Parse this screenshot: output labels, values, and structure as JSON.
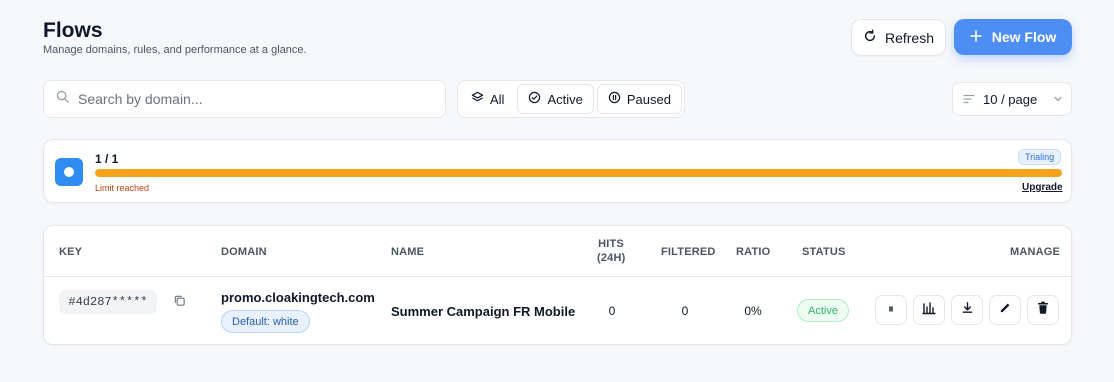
{
  "header": {
    "title": "Flows",
    "subtitle": "Manage domains, rules, and performance at a glance."
  },
  "actions": {
    "refresh_label": "Refresh",
    "new_flow_label": "New Flow"
  },
  "search": {
    "placeholder": "Search by domain...",
    "value": ""
  },
  "filters": [
    {
      "label": "All",
      "icon": "layers-icon",
      "selected": true
    },
    {
      "label": "Active",
      "icon": "check-circle-icon",
      "selected": false
    },
    {
      "label": "Paused",
      "icon": "pause-circle-icon",
      "selected": false
    }
  ],
  "pagination": {
    "page_size_label": "10 / page"
  },
  "limit": {
    "count_label": "1 / 1",
    "used": 1,
    "total": 1,
    "warning": "Limit reached",
    "plan_badge": "Trialing",
    "upgrade_label": "Upgrade",
    "bar_color": "#f5a31a"
  },
  "table": {
    "headers": {
      "key": "KEY",
      "domain": "DOMAIN",
      "name": "NAME",
      "hits_line1": "HITS",
      "hits_line2": "(24H)",
      "filtered": "FILTERED",
      "ratio": "RATIO",
      "status": "STATUS",
      "manage": "MANAGE"
    },
    "rows": [
      {
        "key": "#4d287*****",
        "domain": "promo.cloakingtech.com",
        "default_badge": "Default: white",
        "name": "Summer Campaign FR Mobile",
        "hits": "0",
        "filtered": "0",
        "ratio": "0%",
        "status": "Active",
        "actions": [
          "pause-icon",
          "bar-chart-icon",
          "download-icon",
          "edit-icon",
          "trash-icon"
        ]
      }
    ]
  },
  "colors": {
    "primary": "#4d8ef5",
    "warning": "#f5a31a",
    "success": "#34b36a"
  }
}
